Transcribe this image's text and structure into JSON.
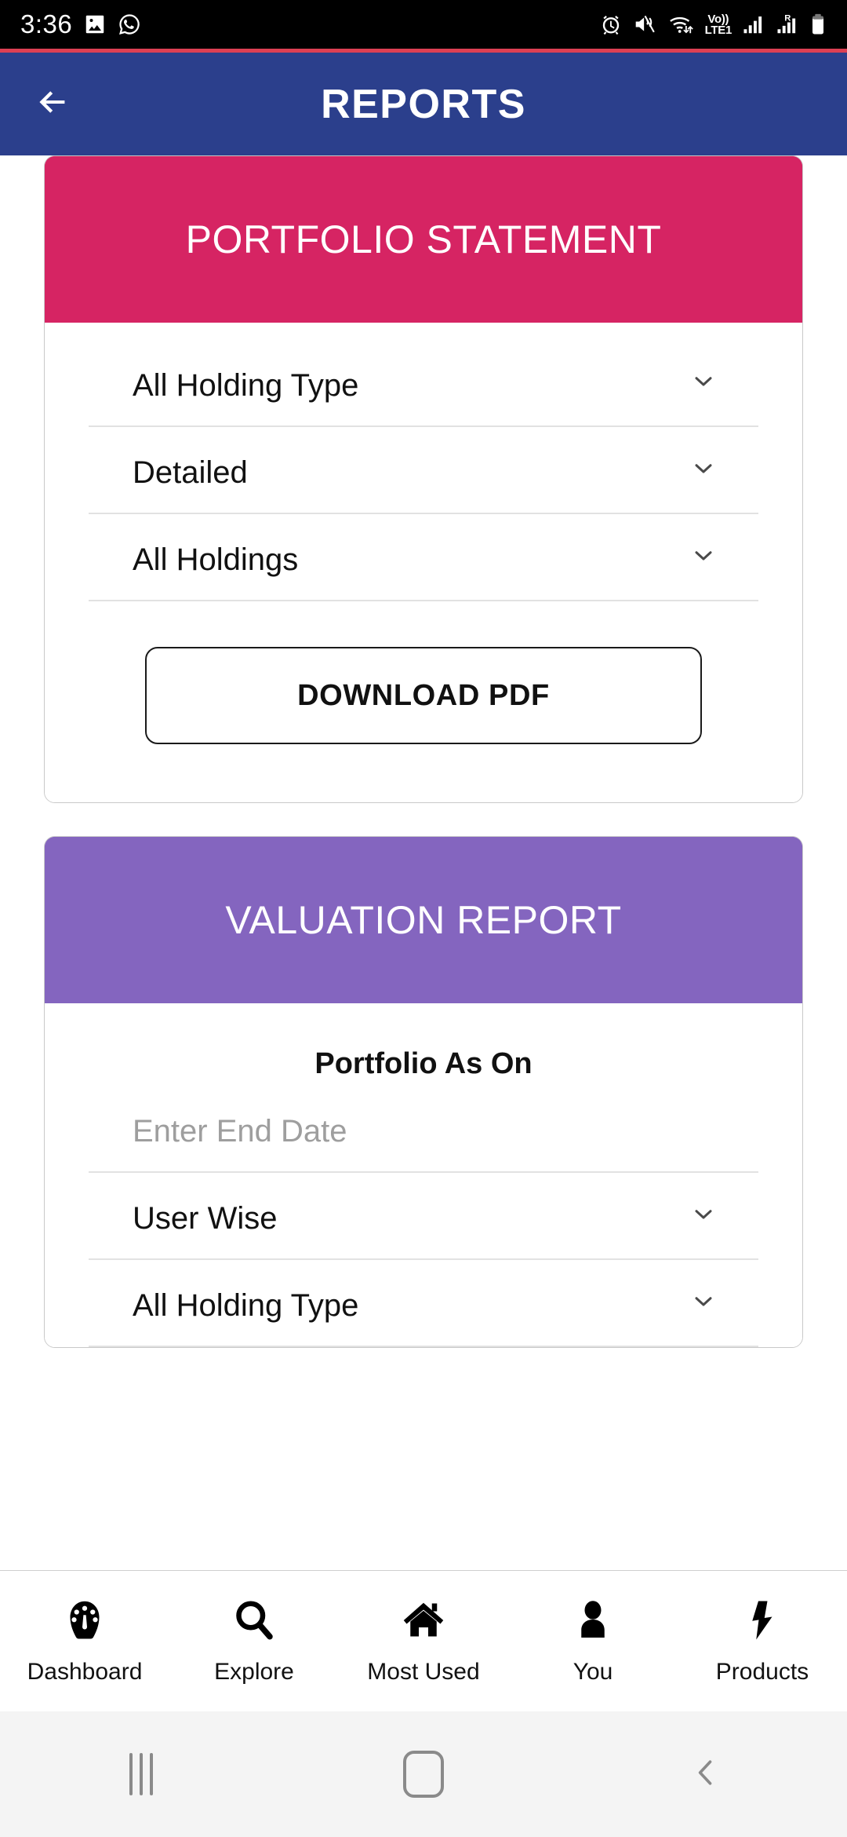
{
  "status_bar": {
    "time": "3:36",
    "left_icons": [
      "photo-icon",
      "whatsapp-icon"
    ],
    "right_icons": [
      "alarm-icon",
      "vibrate-icon",
      "wifi-icon",
      "volte-icon",
      "signal-icon",
      "roaming-signal-icon",
      "battery-icon"
    ],
    "volte_top": "Vo))",
    "volte_bottom": "LTE1",
    "roaming_letter": "R"
  },
  "header": {
    "title": "REPORTS",
    "back_icon": "back-arrow-icon",
    "background": "#2b3f8c",
    "accent_line": "#dd4054"
  },
  "cards": [
    {
      "title": "PORTFOLIO STATEMENT",
      "header_color": "#c40b55",
      "header_arc_color": "#d62463",
      "fields": [
        {
          "value": "All Holding Type",
          "icon": "chevron-down-icon",
          "is_placeholder": false
        },
        {
          "value": "Detailed",
          "icon": "chevron-down-icon",
          "is_placeholder": false
        },
        {
          "value": "All Holdings",
          "icon": "chevron-down-icon",
          "is_placeholder": false
        }
      ],
      "button_label": "DOWNLOAD PDF"
    },
    {
      "title": "VALUATION REPORT",
      "header_color": "#6d4ba8",
      "header_arc_color": "#8465bf",
      "section_label": "Portfolio As On",
      "fields": [
        {
          "value": "Enter End Date",
          "icon": "",
          "is_placeholder": true
        },
        {
          "value": "User Wise",
          "icon": "chevron-down-icon",
          "is_placeholder": false
        },
        {
          "value": "All Holding Type",
          "icon": "chevron-down-icon",
          "is_placeholder": false
        }
      ]
    }
  ],
  "tab_bar": {
    "items": [
      {
        "label": "Dashboard",
        "icon": "speedometer-icon"
      },
      {
        "label": "Explore",
        "icon": "search-icon"
      },
      {
        "label": "Most Used",
        "icon": "home-icon"
      },
      {
        "label": "You",
        "icon": "person-icon"
      },
      {
        "label": "Products",
        "icon": "lightning-bolt-icon"
      }
    ]
  },
  "android_nav": {
    "recents_icon": "recents-icon",
    "home_icon": "home-square-icon",
    "back_icon": "chevron-left-icon"
  }
}
